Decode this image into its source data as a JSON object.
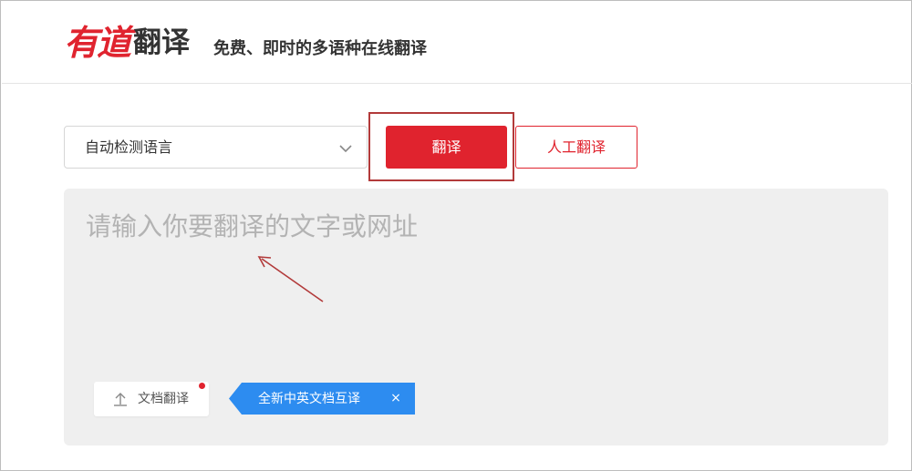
{
  "header": {
    "logo_brand": "有道",
    "logo_product": "翻译",
    "slogan": "免费、即时的多语种在线翻译"
  },
  "controls": {
    "language_select": "自动检测语言",
    "translate_button": "翻译",
    "human_translate_button": "人工翻译"
  },
  "input": {
    "placeholder": "请输入你要翻译的文字或网址",
    "value": ""
  },
  "footer_actions": {
    "doc_translate_label": "文档翻译",
    "promo_label": "全新中英文档互译",
    "promo_close": "×"
  },
  "colors": {
    "brand_red": "#e0232e",
    "promo_blue": "#2d8cf0",
    "annotation_red": "#b23a3a",
    "input_bg": "#efefef"
  },
  "icons": {
    "select_chevron": "chevron-down-icon",
    "doc_upload": "upload-icon",
    "promo_close": "close-icon"
  }
}
